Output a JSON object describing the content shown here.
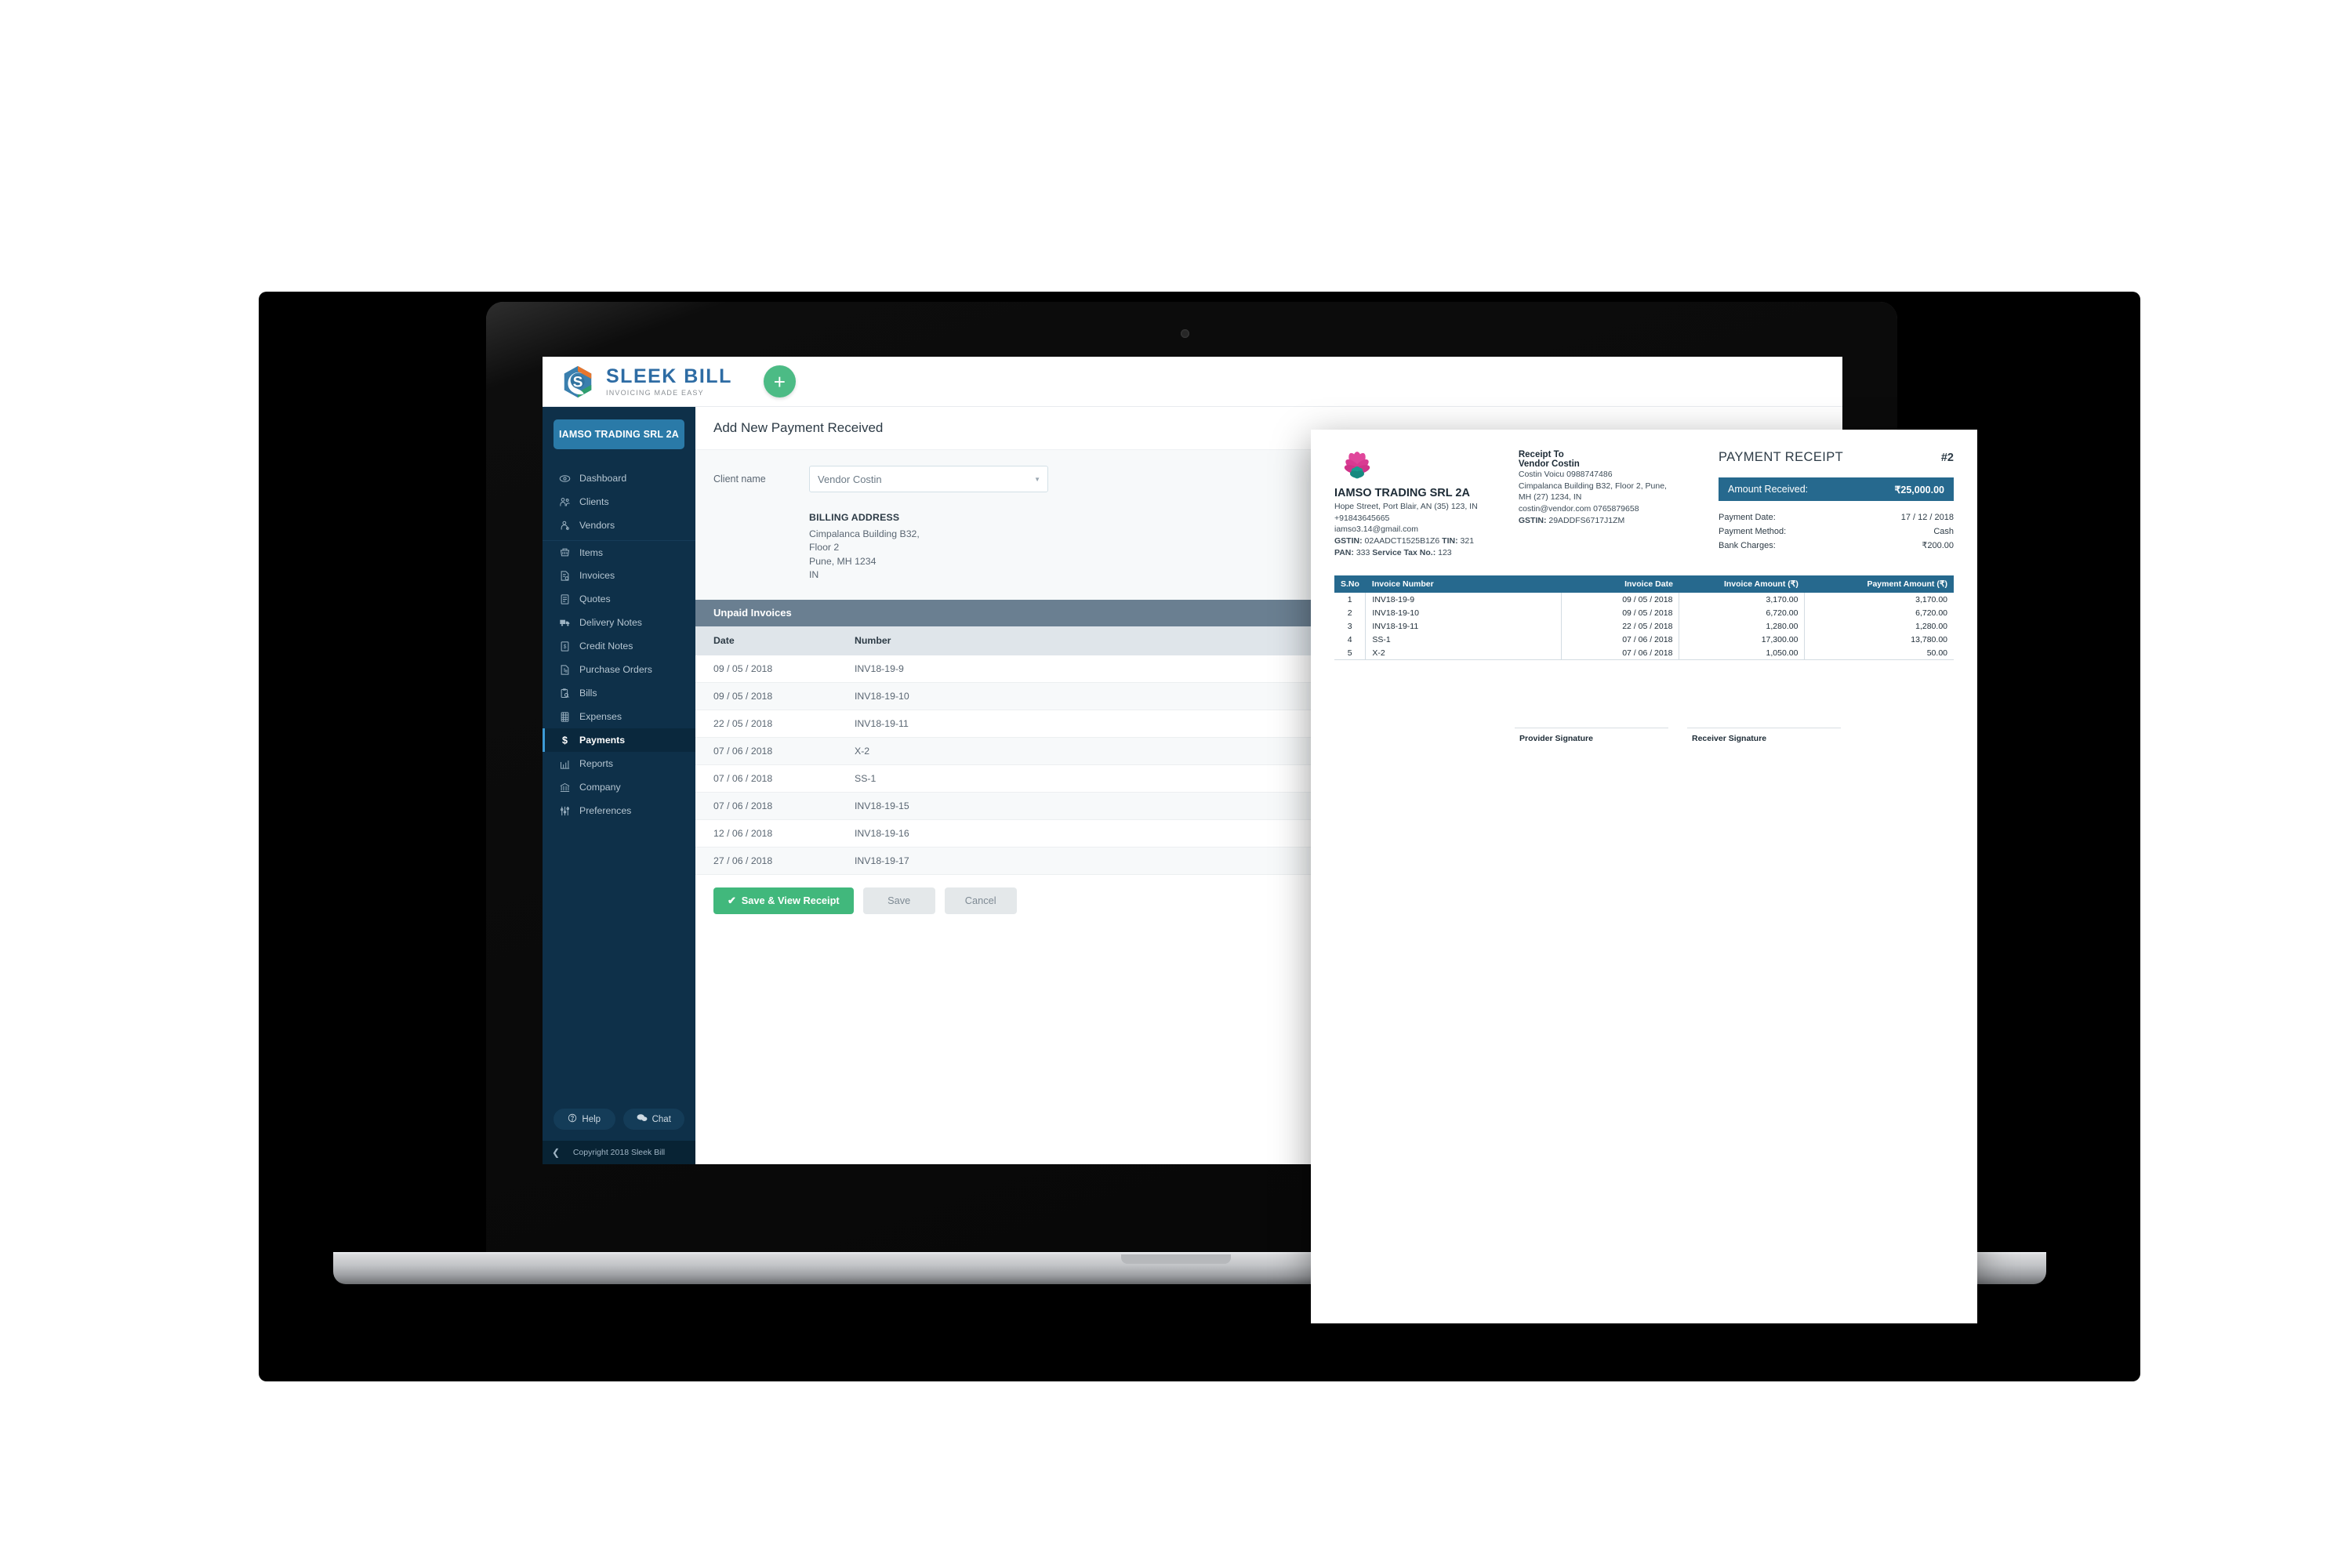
{
  "brand": {
    "logo_title": "SLEEK BILL",
    "logo_subtitle": "INVOICING MADE EASY",
    "accent_green": "#4cbb85",
    "sidebar_bg": "#0e3049",
    "receipt_blue": "#26698e"
  },
  "header": {
    "add_button_label": "+"
  },
  "sidebar": {
    "company_pill": "IAMSO TRADING SRL 2A",
    "items": [
      {
        "label": "Dashboard",
        "icon": "eye-icon",
        "active": false
      },
      {
        "label": "Clients",
        "icon": "clients-icon",
        "active": false
      },
      {
        "label": "Vendors",
        "icon": "vendor-icon",
        "active": false
      },
      {
        "label": "Items",
        "icon": "basket-icon",
        "active": false
      },
      {
        "label": "Invoices",
        "icon": "invoice-icon",
        "active": false
      },
      {
        "label": "Quotes",
        "icon": "quote-icon",
        "active": false
      },
      {
        "label": "Delivery Notes",
        "icon": "truck-icon",
        "active": false
      },
      {
        "label": "Credit Notes",
        "icon": "credit-note-icon",
        "active": false
      },
      {
        "label": "Purchase Orders",
        "icon": "purchase-order-icon",
        "active": false
      },
      {
        "label": "Bills",
        "icon": "bills-icon",
        "active": false
      },
      {
        "label": "Expenses",
        "icon": "calculator-icon",
        "active": false
      },
      {
        "label": "Payments",
        "icon": "dollar-icon",
        "active": true
      },
      {
        "label": "Reports",
        "icon": "chart-icon",
        "active": false
      },
      {
        "label": "Company",
        "icon": "bank-icon",
        "active": false
      },
      {
        "label": "Preferences",
        "icon": "sliders-icon",
        "active": false
      }
    ],
    "help_label": "Help",
    "chat_label": "Chat",
    "copyright": "Copyright 2018 Sleek Bill"
  },
  "main": {
    "page_title": "Add New Payment Received",
    "client_label": "Client name",
    "client_value": "Vendor Costin",
    "billing_heading": "BILLING ADDRESS",
    "billing_lines": [
      "Cimpalanca Building B32,",
      "Floor 2",
      "Pune, MH 1234",
      "IN"
    ],
    "table_section_title": "Unpaid Invoices",
    "table_headers": [
      "Date",
      "Number"
    ],
    "rows": [
      {
        "date": "09 / 05 / 2018",
        "number": "INV18-19-9"
      },
      {
        "date": "09 / 05 / 2018",
        "number": "INV18-19-10"
      },
      {
        "date": "22 / 05 / 2018",
        "number": "INV18-19-11"
      },
      {
        "date": "07 / 06 / 2018",
        "number": "X-2"
      },
      {
        "date": "07 / 06 / 2018",
        "number": "SS-1"
      },
      {
        "date": "07 / 06 / 2018",
        "number": "INV18-19-15"
      },
      {
        "date": "12 / 06 / 2018",
        "number": "INV18-19-16"
      },
      {
        "date": "27 / 06 / 2018",
        "number": "INV18-19-17"
      }
    ],
    "save_view_label": "Save & View Receipt",
    "save_label": "Save",
    "cancel_label": "Cancel"
  },
  "receipt": {
    "title": "PAYMENT RECEIPT",
    "number": "#2",
    "company_name": "IAMSO TRADING SRL 2A",
    "company_address": "Hope Street, Port Blair, AN (35) 123, IN",
    "company_phone": "+91843645665",
    "company_email": "iamso3.14@gmail.com",
    "company_gstin_label": "GSTIN:",
    "company_gstin": "02AADCT1525B1Z6",
    "company_tin_label": "TIN:",
    "company_tin": "321",
    "company_pan_label": "PAN:",
    "company_pan": "333",
    "company_stn_label": "Service Tax No.:",
    "company_stn": "123",
    "receipt_to_label": "Receipt To",
    "party_name": "Vendor Costin",
    "party_contact": "Costin Voicu 0988747486",
    "party_address_1": "Cimpalanca Building B32, Floor 2, Pune,",
    "party_address_2": "MH (27) 1234, IN",
    "party_email": "costin@vendor.com 0765879658",
    "party_gstin_label": "GSTIN:",
    "party_gstin": "29ADDFS6717J1ZM",
    "amount_label": "Amount Received:",
    "amount_value": "₹25,000.00",
    "meta": [
      {
        "label": "Payment Date:",
        "value": "17 / 12 / 2018"
      },
      {
        "label": "Payment Method:",
        "value": "Cash"
      },
      {
        "label": "Bank Charges:",
        "value": "₹200.00"
      }
    ],
    "table_headers": [
      "S.No",
      "Invoice Number",
      "Invoice Date",
      "Invoice Amount (₹)",
      "Payment Amount (₹)"
    ],
    "table_rows": [
      {
        "sno": "1",
        "invoice": "INV18-19-9",
        "date": "09 / 05 / 2018",
        "amount": "3,170.00",
        "payment": "3,170.00"
      },
      {
        "sno": "2",
        "invoice": "INV18-19-10",
        "date": "09 / 05 / 2018",
        "amount": "6,720.00",
        "payment": "6,720.00"
      },
      {
        "sno": "3",
        "invoice": "INV18-19-11",
        "date": "22 / 05 / 2018",
        "amount": "1,280.00",
        "payment": "1,280.00"
      },
      {
        "sno": "4",
        "invoice": "SS-1",
        "date": "07 / 06 / 2018",
        "amount": "17,300.00",
        "payment": "13,780.00"
      },
      {
        "sno": "5",
        "invoice": "X-2",
        "date": "07 / 06 / 2018",
        "amount": "1,050.00",
        "payment": "50.00"
      }
    ],
    "provider_signature_label": "Provider Signature",
    "receiver_signature_label": "Receiver Signature"
  }
}
